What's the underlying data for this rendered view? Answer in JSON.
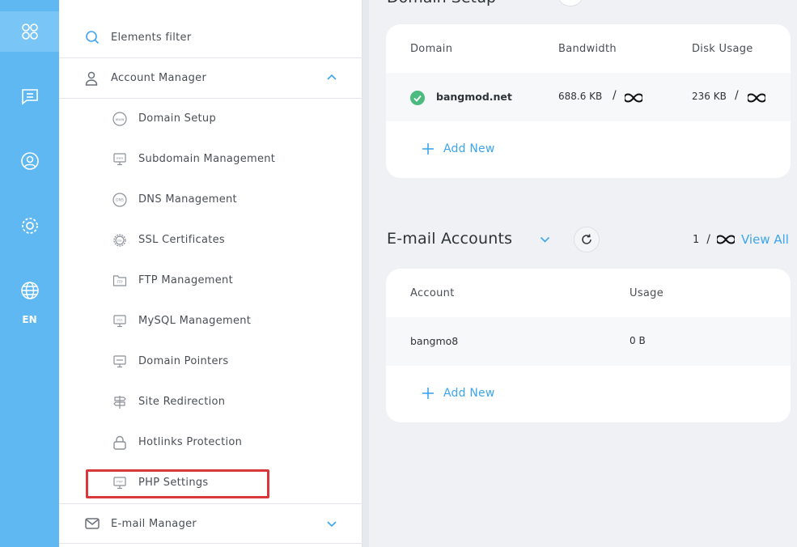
{
  "rail": {
    "items": [
      {
        "icon": "apps-icon",
        "active": true
      },
      {
        "icon": "message-icon",
        "active": false
      },
      {
        "icon": "user-circle-icon",
        "active": false
      },
      {
        "icon": "settings-gear-icon",
        "active": false
      },
      {
        "icon": "globe-icon",
        "active": false
      }
    ],
    "language": "EN"
  },
  "sidebar": {
    "filter_placeholder": "Elements filter",
    "account_manager": "Account Manager",
    "items": [
      {
        "label": "Domain Setup",
        "icon": "www-icon"
      },
      {
        "label": "Subdomain Management",
        "icon": "subdomain-icon"
      },
      {
        "label": "DNS Management",
        "icon": "dns-icon"
      },
      {
        "label": "SSL Certificates",
        "icon": "ssl-badge-icon"
      },
      {
        "label": "FTP Management",
        "icon": "ftp-folder-icon"
      },
      {
        "label": "MySQL Management",
        "icon": "mysql-icon"
      },
      {
        "label": "Domain Pointers",
        "icon": "domain-pointer-icon"
      },
      {
        "label": "Site Redirection",
        "icon": "signpost-icon"
      },
      {
        "label": "Hotlinks Protection",
        "icon": "lock-icon"
      },
      {
        "label": "PHP Settings",
        "icon": "php-icon"
      }
    ],
    "email_manager": "E-mail Manager"
  },
  "domain_setup": {
    "columns": [
      "Domain",
      "Bandwidth",
      "Disk Usage"
    ],
    "rows": [
      {
        "domain": "bangmod.net",
        "bandwidth": "688.6 KB",
        "disk": "236 KB",
        "separator": "/"
      }
    ],
    "add_new": "Add New"
  },
  "email_accounts": {
    "title": "E-mail Accounts",
    "count": "1",
    "separator": "/",
    "view_all": "View All",
    "columns": [
      "Account",
      "Usage"
    ],
    "rows": [
      {
        "account": "bangmo8",
        "usage": "0 B"
      }
    ],
    "add_new": "Add New"
  },
  "colors": {
    "rail": "#5fb8f2",
    "accent": "#3da5ee",
    "success": "#4cbb7f",
    "highlight": "#d9383a"
  }
}
